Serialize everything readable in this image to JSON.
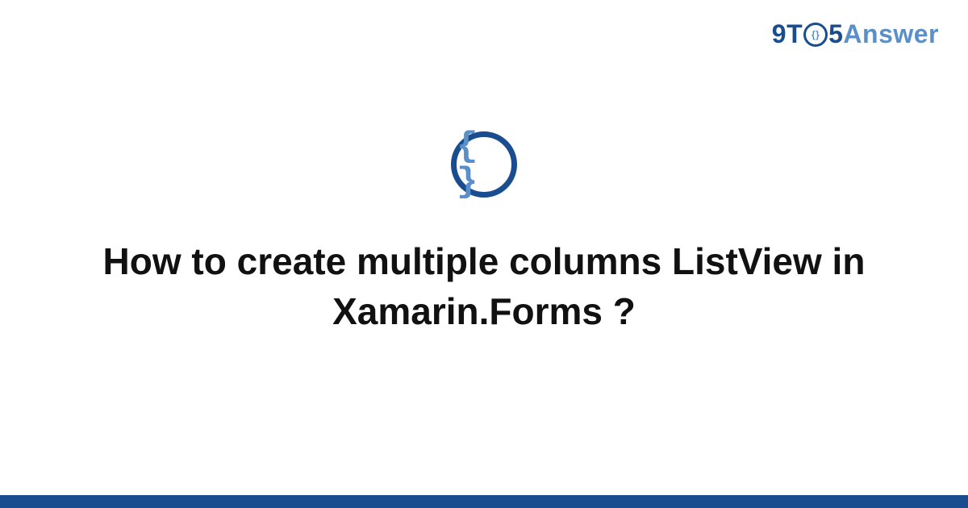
{
  "logo": {
    "part1": "9T",
    "clock_inner": "{}",
    "part2": "5",
    "part3": "Answer"
  },
  "icon": {
    "braces": "{ }"
  },
  "title": "How to create multiple columns ListView in Xamarin.Forms ?",
  "colors": {
    "primary": "#1a4d8f",
    "secondary": "#5a8fc7",
    "text": "#111111"
  }
}
